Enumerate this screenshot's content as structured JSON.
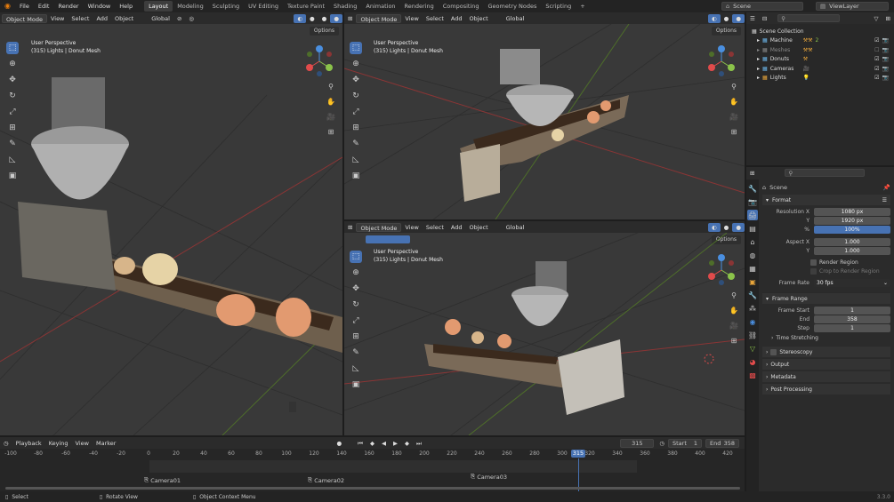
{
  "topbar": {
    "menu": [
      "File",
      "Edit",
      "Render",
      "Window",
      "Help"
    ],
    "workspaces": [
      "Layout",
      "Modeling",
      "Sculpting",
      "UV Editing",
      "Texture Paint",
      "Shading",
      "Animation",
      "Rendering",
      "Compositing",
      "Geometry Nodes",
      "Scripting"
    ],
    "active_workspace": "Layout",
    "add_tab": "+",
    "scene": "Scene",
    "view_layer": "ViewLayer"
  },
  "viewport_header": {
    "mode": "Object Mode",
    "view": "View",
    "select": "Select",
    "add": "Add",
    "object": "Object",
    "orientation": "Global",
    "options": "Options"
  },
  "viewports": [
    {
      "perspective": "User Perspective",
      "info": "(315) Lights | Donut Mesh"
    },
    {
      "perspective": "User Perspective",
      "info": "(315) Lights | Donut Mesh"
    },
    {
      "perspective": "User Perspective",
      "info": "(315) Lights | Donut Mesh"
    }
  ],
  "gizmo": {
    "x": "X",
    "y": "Y",
    "z": "Z"
  },
  "outliner": {
    "root": "Scene Collection",
    "items": [
      {
        "name": "Machine",
        "color": "#6bb5e8",
        "count": "2"
      },
      {
        "name": "Meshes",
        "color": "#777777",
        "count": ""
      },
      {
        "name": "Donuts",
        "color": "#6bb5e8",
        "count": ""
      },
      {
        "name": "Cameras",
        "color": "#6bb5e8",
        "count": ""
      },
      {
        "name": "Lights",
        "color": "#e8a53b",
        "count": ""
      }
    ]
  },
  "properties": {
    "scene_name": "Scene",
    "format": {
      "title": "Format",
      "resolution_x_label": "Resolution X",
      "resolution_x": "1080 px",
      "y_label": "Y",
      "y": "1920 px",
      "percent_label": "%",
      "percent": "100%",
      "aspect_x_label": "Aspect X",
      "aspect_x": "1.000",
      "aspect_y_label": "Y",
      "aspect_y": "1.000",
      "render_region": "Render Region",
      "crop_region": "Crop to Render Region",
      "frame_rate_label": "Frame Rate",
      "frame_rate": "30 fps"
    },
    "frame_range": {
      "title": "Frame Range",
      "start_label": "Frame Start",
      "start": "1",
      "end_label": "End",
      "end": "358",
      "step_label": "Step",
      "step": "1",
      "time_stretching": "Time Stretching"
    },
    "panels": [
      "Stereoscopy",
      "Output",
      "Metadata",
      "Post Processing"
    ]
  },
  "timeline": {
    "menus": [
      "Playback",
      "Keying",
      "View",
      "Marker"
    ],
    "current_frame": "315",
    "start_label": "Start",
    "start": "1",
    "end_label": "End",
    "end": "358",
    "ticks": [
      "-100",
      "-80",
      "-60",
      "-40",
      "-20",
      "0",
      "20",
      "40",
      "60",
      "80",
      "100",
      "120",
      "140",
      "160",
      "180",
      "200",
      "220",
      "240",
      "260",
      "280",
      "300",
      "320",
      "340",
      "360",
      "380",
      "400",
      "420"
    ],
    "cursor_frame": "315",
    "markers": [
      "Camera01",
      "Camera02",
      "Camera03"
    ]
  },
  "statusbar": {
    "select": "Select",
    "rotate": "Rotate View",
    "context": "Object Context Menu",
    "version": "3.3.0"
  },
  "colors": {
    "accent": "#4772b3",
    "x_axis": "#e14b4b",
    "y_axis": "#8bc34a",
    "z_axis": "#4a8fe0"
  }
}
